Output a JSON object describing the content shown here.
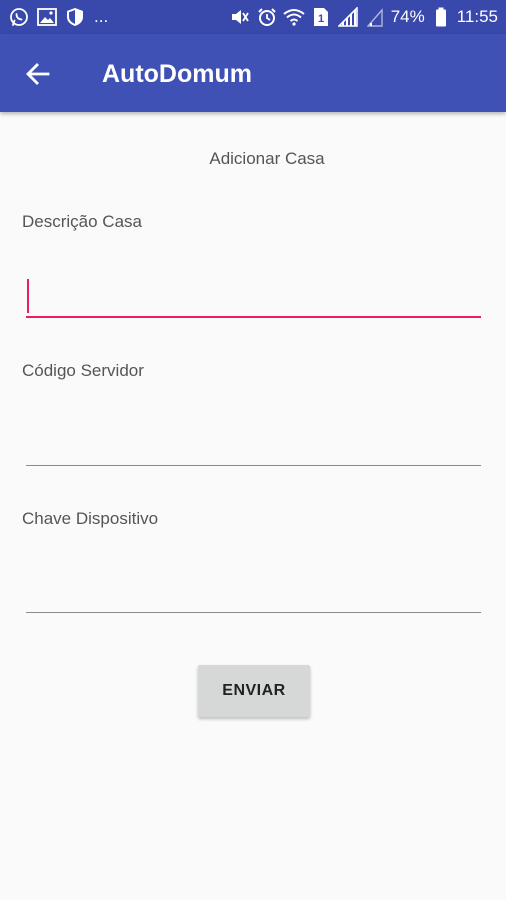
{
  "status_bar": {
    "left_icons": [
      "whatsapp-icon",
      "image-icon",
      "shield-icon"
    ],
    "overflow_dots": "...",
    "right_icons": [
      "mute-icon",
      "alarm-icon",
      "wifi-icon",
      "sim-icon",
      "signal-icon",
      "signal-weak-icon",
      "battery-icon"
    ],
    "sim_number": "1",
    "battery": "74%",
    "time": "11:55"
  },
  "app_bar": {
    "back_icon": "arrow-back-icon",
    "title": "AutoDomum",
    "color": "#3f51b5"
  },
  "form": {
    "title": "Adicionar Casa",
    "fields": [
      {
        "label": "Descrição Casa",
        "value": "",
        "active": true
      },
      {
        "label": "Código Servidor",
        "value": ""
      },
      {
        "label": "Chave Dispositivo",
        "value": ""
      }
    ],
    "accent_color": "#e91e63",
    "submit_label": "ENVIAR"
  }
}
